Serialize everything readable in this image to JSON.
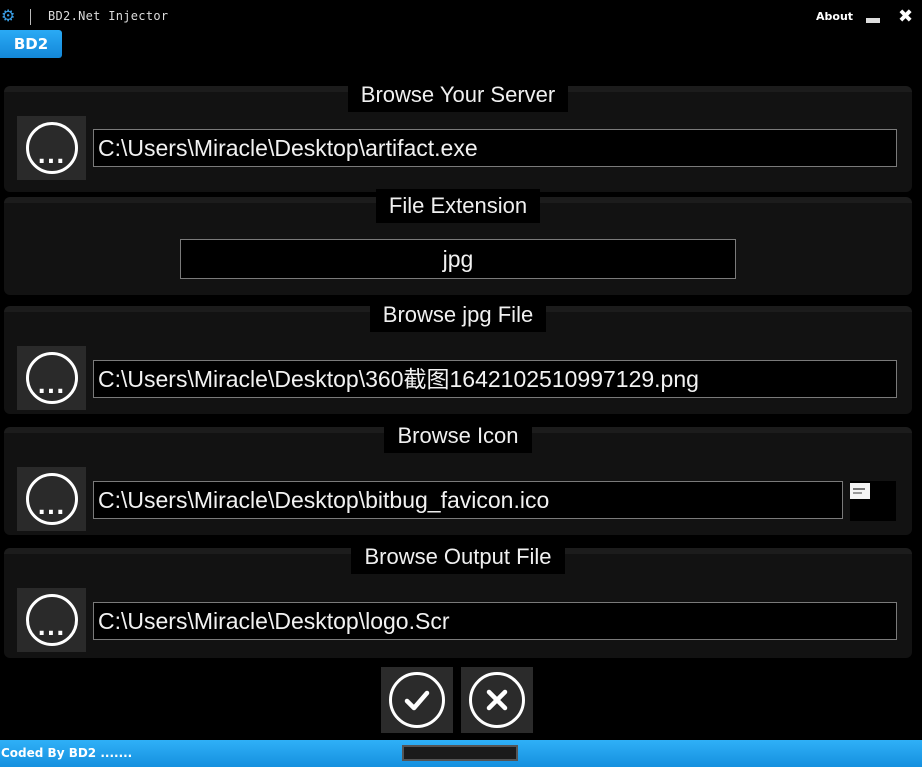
{
  "window": {
    "title": "BD2.Net Injector",
    "about_label": "About",
    "logo_glyph": "⚙",
    "close_glyph": "✖"
  },
  "tab": {
    "label": "BD2"
  },
  "sections": {
    "server": {
      "title": "Browse Your Server",
      "path": "C:\\Users\\Miracle\\Desktop\\artifact.exe",
      "button_glyph": "..."
    },
    "extension": {
      "title": "File Extension",
      "value": "jpg"
    },
    "jpg": {
      "title": "Browse jpg File",
      "path": "C:\\Users\\Miracle\\Desktop\\360截图1642102510997129.png",
      "button_glyph": "..."
    },
    "icon": {
      "title": "Browse Icon",
      "path": "C:\\Users\\Miracle\\Desktop\\bitbug_favicon.ico",
      "button_glyph": "..."
    },
    "output": {
      "title": "Browse Output File",
      "path": "C:\\Users\\Miracle\\Desktop\\logo.Scr",
      "button_glyph": "..."
    }
  },
  "status": {
    "text": "Coded By BD2 .......",
    "progress": 0
  },
  "colors": {
    "accent": "#1e9be8",
    "panel": "#121212",
    "background": "#000000"
  },
  "icons": [
    "app-logo-icon",
    "minimize-icon",
    "close-icon",
    "browse-icon",
    "confirm-check-icon",
    "cancel-x-icon"
  ]
}
